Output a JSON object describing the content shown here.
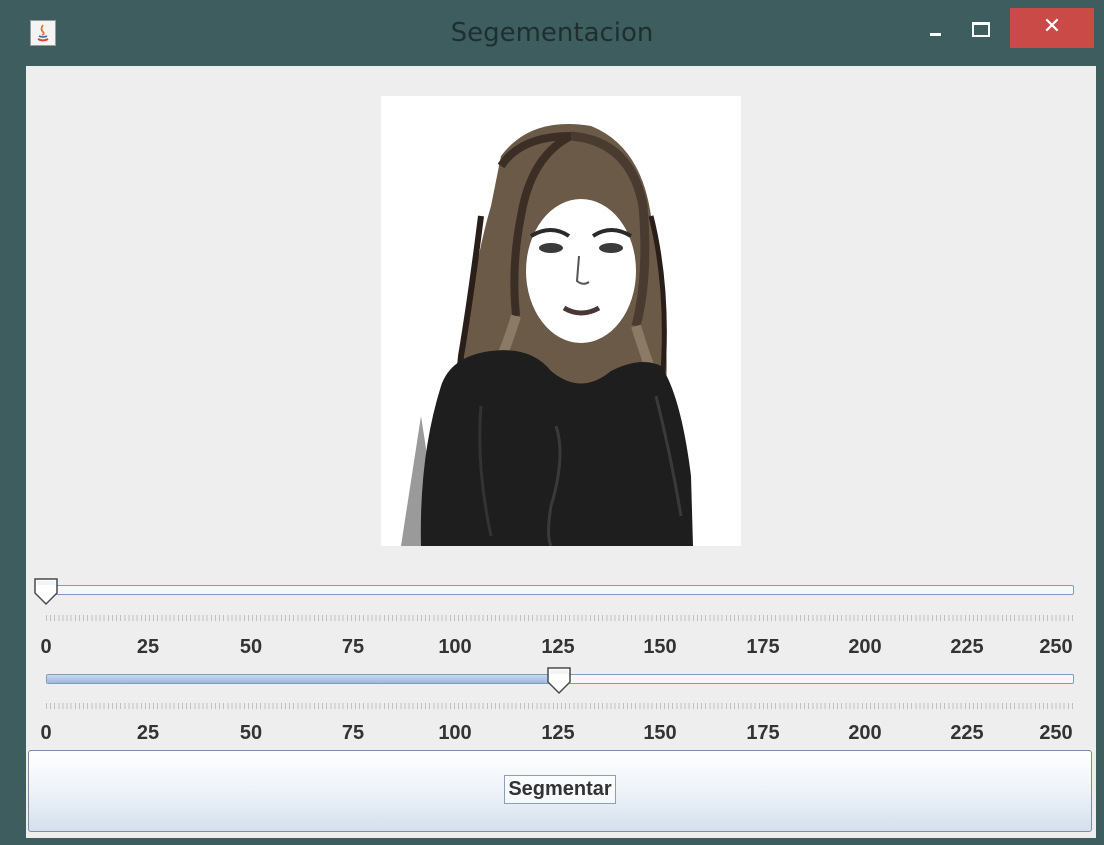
{
  "window": {
    "title": "Segementacion",
    "close_symbol": "✕",
    "icons": {
      "app": "java-icon",
      "minimize": "minimize-icon",
      "maximize": "maximize-icon",
      "close": "close-icon"
    }
  },
  "image": {
    "description_icon": "segmented-portrait-image"
  },
  "slider1": {
    "value": 0,
    "min": 0,
    "max": 250
  },
  "slider2": {
    "value": 125,
    "min": 0,
    "max": 250
  },
  "tick_labels": [
    "0",
    "25",
    "50",
    "75",
    "100",
    "125",
    "150",
    "175",
    "200",
    "225",
    "250"
  ],
  "button": {
    "label": "Segmentar"
  }
}
